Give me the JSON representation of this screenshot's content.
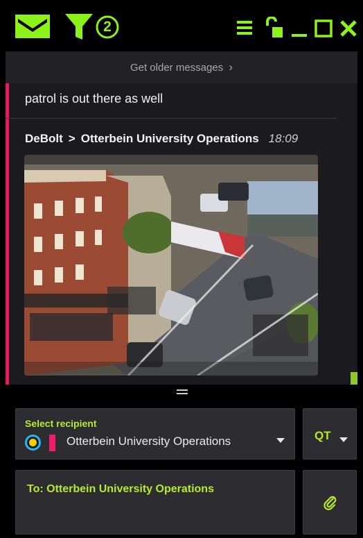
{
  "titlebar": {
    "filter_count": "2",
    "icons": [
      "inbox-icon",
      "filter-icon",
      "menu-icon",
      "unlock-icon",
      "minimize-icon",
      "maximize-icon",
      "close-icon"
    ],
    "accent_color": "#8df21a"
  },
  "history": {
    "older_label": "Get older messages",
    "older_chevron": "›"
  },
  "chat": {
    "previous_message": "patrol is out there as well",
    "message": {
      "sender": "DeBolt",
      "separator": ">",
      "recipient": "Otterbein University Operations",
      "time": "18:09",
      "attachment": "photo"
    },
    "accent_color": "#e8195e"
  },
  "composer": {
    "recipient_label": "Select recipient",
    "recipient_value": "Otterbein University Operations",
    "priority_label": "QT",
    "to_line": "To: Otterbein University Operations",
    "label_color": "#b6ec2a"
  }
}
